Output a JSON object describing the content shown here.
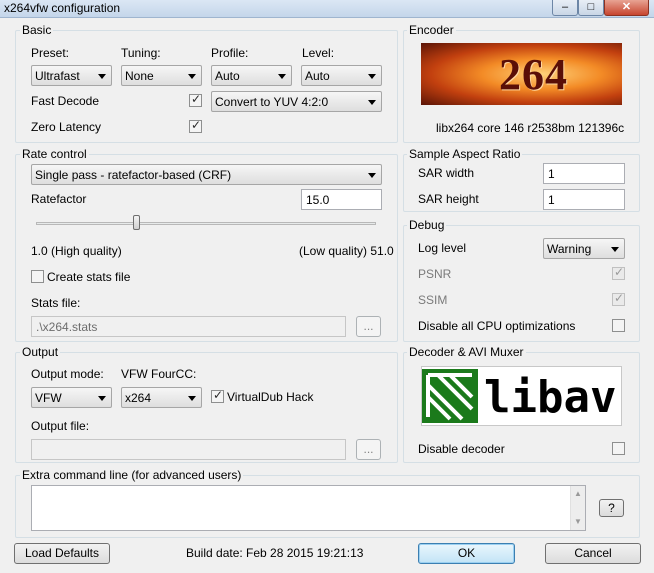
{
  "window": {
    "title": "x264vfw configuration",
    "min_glyph": "‒",
    "max_glyph": "□",
    "close_glyph": "✕"
  },
  "basic": {
    "group_label": "Basic",
    "preset_label": "Preset:",
    "preset_value": "Ultrafast",
    "tuning_label": "Tuning:",
    "tuning_value": "None",
    "profile_label": "Profile:",
    "profile_value": "Auto",
    "level_label": "Level:",
    "level_value": "Auto",
    "fast_decode_label": "Fast Decode",
    "fast_decode_checked": true,
    "zero_latency_label": "Zero Latency",
    "zero_latency_checked": true,
    "colorspace_value": "Convert to YUV 4:2:0"
  },
  "encoder": {
    "group_label": "Encoder",
    "logo_text": "264",
    "version_text": "libx264 core 146 r2538bm 121396c"
  },
  "rate_control": {
    "group_label": "Rate control",
    "mode_value": "Single pass - ratefactor-based (CRF)",
    "ratefactor_label": "Ratefactor",
    "ratefactor_value": "15.0",
    "slider_fraction": 0.29,
    "low_end_label": "1.0 (High quality)",
    "high_end_label": "(Low quality) 51.0",
    "create_stats_label": "Create stats file",
    "create_stats_checked": false,
    "stats_file_label": "Stats file:",
    "stats_file_value": ".\\x264.stats",
    "browse_label": "..."
  },
  "sar": {
    "group_label": "Sample Aspect Ratio",
    "width_label": "SAR width",
    "width_value": "1",
    "height_label": "SAR height",
    "height_value": "1"
  },
  "debug": {
    "group_label": "Debug",
    "log_level_label": "Log level",
    "log_level_value": "Warning",
    "psnr_label": "PSNR",
    "psnr_checked": true,
    "ssim_label": "SSIM",
    "ssim_checked": true,
    "disable_cpu_label": "Disable all CPU optimizations",
    "disable_cpu_checked": false
  },
  "output": {
    "group_label": "Output",
    "mode_label": "Output mode:",
    "mode_value": "VFW",
    "fourcc_label": "VFW FourCC:",
    "fourcc_value": "x264",
    "vdub_hack_label": "VirtualDub Hack",
    "vdub_hack_checked": true,
    "file_label": "Output file:",
    "file_value": "",
    "browse_label": "..."
  },
  "decoder": {
    "group_label": "Decoder & AVI Muxer",
    "logo_text": "libav",
    "disable_decoder_label": "Disable decoder",
    "disable_decoder_checked": false
  },
  "extra": {
    "group_label": "Extra command line (for advanced users)",
    "value": "",
    "help_label": "?"
  },
  "footer": {
    "load_defaults_label": "Load Defaults",
    "build_date": "Build date: Feb 28 2015 19:21:13",
    "ok_label": "OK",
    "cancel_label": "Cancel"
  }
}
